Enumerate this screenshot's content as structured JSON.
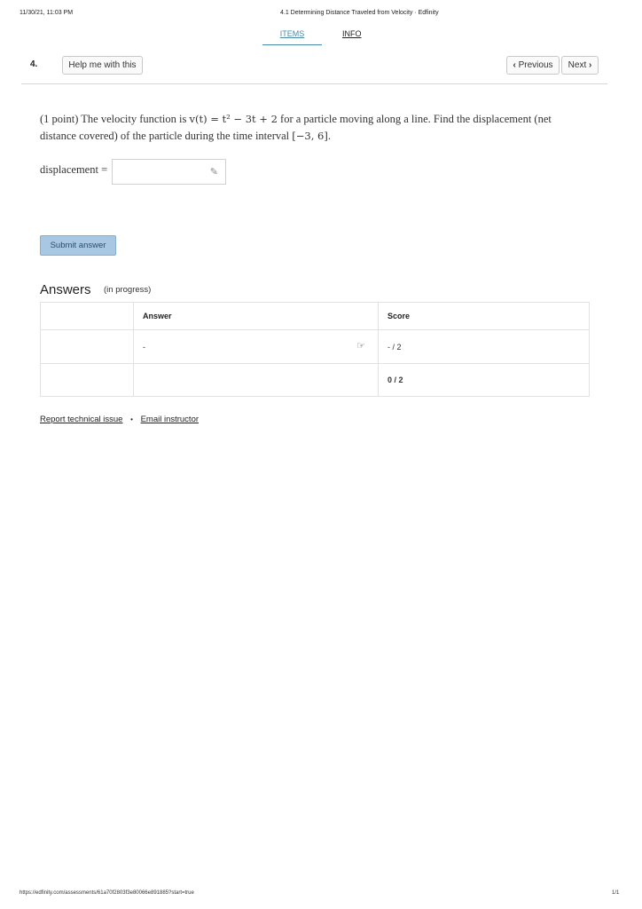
{
  "print_header": {
    "datetime": "11/30/21, 11:03 PM",
    "title": "4.1 Determining Distance Traveled from Velocity · Edfinity"
  },
  "tabs": [
    {
      "label": "ITEMS",
      "active": true
    },
    {
      "label": "INFO",
      "active": false
    }
  ],
  "question": {
    "number": "4.",
    "help_label": "Help me with this",
    "prev_label": "Previous",
    "next_label": "Next",
    "text_prefix": "(1 point) The velocity function is ",
    "velocity_expr": "v(t) = t² − 3t + 2",
    "text_middle": " for a particle moving along a line. Find the displacement (net distance covered) of the particle during the time interval ",
    "interval": "[−3, 6]",
    "text_suffix": ".",
    "input_label": "displacement =",
    "input_value": "",
    "submit_label": "Submit answer"
  },
  "answers": {
    "title": "Answers",
    "subtitle": "(in progress)",
    "headers": [
      "",
      "Answer",
      "Score"
    ],
    "rows": [
      {
        "label": "",
        "answer": "-",
        "score": "- / 2"
      }
    ],
    "total": {
      "label": "",
      "answer": "",
      "score": "0 / 2"
    }
  },
  "links": {
    "report": "Report technical issue",
    "separator": "•",
    "email": "Email instructor"
  },
  "print_footer": {
    "url": "https://edfinity.com/assessments/61a70f2803f3e80066e891885?start=true",
    "page": "1/1"
  },
  "colors": {
    "accent": "#4a88a8",
    "submit_bg": "#a7c7e2"
  }
}
